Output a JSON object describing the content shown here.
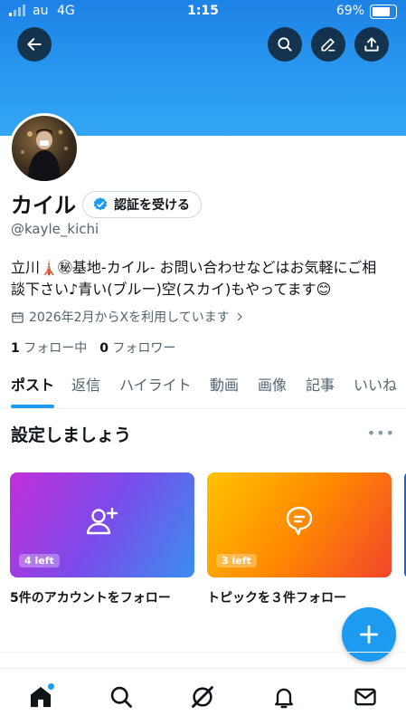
{
  "status_bar": {
    "carrier": "au",
    "network": "4G",
    "time": "1:15",
    "battery": "69%"
  },
  "header": {
    "back_icon": "arrow-left-icon",
    "search_icon": "search-icon",
    "edit_icon": "pencil-icon",
    "share_icon": "share-icon"
  },
  "profile": {
    "name": "カイル",
    "verify_label": "認証を受ける",
    "handle": "@kayle_kichi",
    "bio": "立川🗼㊙基地-カイル- お問い合わせなどはお気軽にご相談下さい♪青い(ブルー)空(スカイ)もやってます😊",
    "joined": "2026年2月からXを利用しています",
    "following_count": "1",
    "following_label": "フォロー中",
    "followers_count": "0",
    "followers_label": "フォロワー"
  },
  "tabs": [
    {
      "label": "ポスト",
      "active": true
    },
    {
      "label": "返信"
    },
    {
      "label": "ハイライト"
    },
    {
      "label": "動画"
    },
    {
      "label": "画像"
    },
    {
      "label": "記事"
    },
    {
      "label": "いいね"
    }
  ],
  "setup": {
    "title": "設定しましょう",
    "more": "•••",
    "cards": [
      {
        "badge": "4 left",
        "label": "5件のアカウントをフォロー",
        "icon": "add-user-icon"
      },
      {
        "badge": "3 left",
        "label": "トピックを３件フォロー",
        "icon": "topic-icon"
      }
    ]
  },
  "colors": {
    "accent": "#1d9bf0",
    "banner": "#2a9af0"
  },
  "bottom_nav": [
    "home-icon",
    "search-icon",
    "grok-icon",
    "notifications-icon",
    "messages-icon"
  ]
}
